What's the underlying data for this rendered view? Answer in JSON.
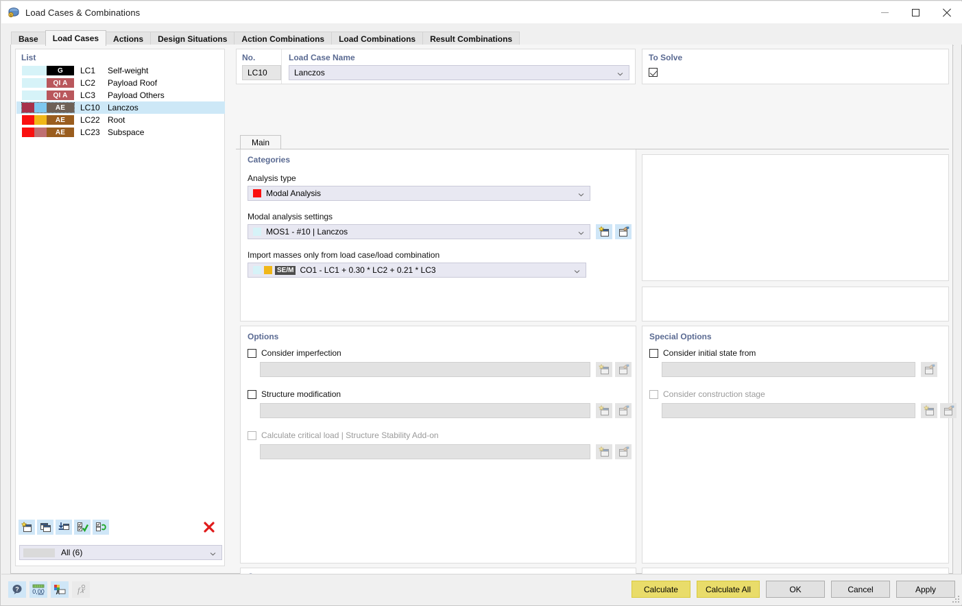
{
  "window": {
    "title": "Load Cases & Combinations",
    "icon": "load-cases-icon",
    "minimize": "minimize-icon",
    "maximize": "maximize-icon",
    "close": "close-icon"
  },
  "tabs": [
    {
      "label": "Base",
      "active": false
    },
    {
      "label": "Load Cases",
      "active": true
    },
    {
      "label": "Actions",
      "active": false
    },
    {
      "label": "Design Situations",
      "active": false
    },
    {
      "label": "Action Combinations",
      "active": false
    },
    {
      "label": "Load Combinations",
      "active": false
    },
    {
      "label": "Result Combinations",
      "active": false
    }
  ],
  "list": {
    "title": "List",
    "rows": [
      {
        "no": "LC1",
        "name": "Self-weight",
        "cat": "G",
        "c1": "#d6f3f8",
        "c2": "#d6f3f8",
        "cat_bg": "#000000",
        "selected": false
      },
      {
        "no": "LC2",
        "name": "Payload Roof",
        "cat": "QI A",
        "c1": "#d6f3f8",
        "c2": "#d6f3f8",
        "cat_bg": "#b9575c",
        "selected": false
      },
      {
        "no": "LC3",
        "name": "Payload Others",
        "cat": "QI A",
        "c1": "#d6f3f8",
        "c2": "#d6f3f8",
        "cat_bg": "#b9575c",
        "selected": false
      },
      {
        "no": "LC10",
        "name": "Lanczos",
        "cat": "AE",
        "c1": "#a8304a",
        "c2": "#7ec8ef",
        "cat_bg": "#6e6056",
        "selected": true
      },
      {
        "no": "LC22",
        "name": "Root",
        "cat": "AE",
        "c1": "#fa0f0f",
        "c2": "#f0b719",
        "cat_bg": "#9a5d1e",
        "selected": false
      },
      {
        "no": "LC23",
        "name": "Subspace",
        "cat": "AE",
        "c1": "#fa0f0f",
        "c2": "#bf6f72",
        "cat_bg": "#9a5d1e",
        "selected": false
      }
    ],
    "toolbar": [
      {
        "name": "new-load-case-button",
        "icon": "new-window-star-icon"
      },
      {
        "name": "copy-load-case-button",
        "icon": "copy-windows-icon"
      },
      {
        "name": "import-load-case-button",
        "icon": "import-down-arrow-icon"
      },
      {
        "name": "select-all-button",
        "icon": "checkbox-check-icon"
      },
      {
        "name": "invert-selection-button",
        "icon": "checkbox-swap-icon"
      },
      {
        "name": "delete-load-case-button",
        "icon": "red-x-icon"
      }
    ],
    "filter": {
      "value": "All (6)",
      "caret": "chevron-down-icon"
    }
  },
  "header": {
    "no_label": "No.",
    "no_value": "LC10",
    "name_label": "Load Case Name",
    "name_value": "Lanczos",
    "name_caret": "chevron-down-icon"
  },
  "to_solve": {
    "label": "To Solve",
    "checked": true
  },
  "main_tab": {
    "label": "Main"
  },
  "categories": {
    "title": "Categories",
    "analysis_type_label": "Analysis type",
    "analysis_type_value": "Modal Analysis",
    "analysis_type_color": "#fa0f0f",
    "analysis_type_caret": "chevron-down-icon",
    "modal_settings_label": "Modal analysis settings",
    "modal_settings_value": "MOS1 - #10 | Lanczos",
    "modal_settings_color": "#d6f3f8",
    "modal_settings_caret": "chevron-down-icon",
    "modal_new_icon": "new-window-star-icon",
    "modal_edit_icon": "edit-window-icon",
    "import_masses_label": "Import masses only from load case/load combination",
    "import_masses_value": "CO1 - LC1 + 0.30 * LC2 + 0.21 * LC3",
    "import_masses_badge": "SE/M",
    "import_masses_badge_bg": "#4d4d4d",
    "import_masses_c1": "#d6f3f8",
    "import_masses_c2": "#f0b719",
    "import_masses_caret": "chevron-down-icon"
  },
  "options": {
    "title": "Options",
    "items": [
      {
        "label": "Consider imperfection",
        "checked": false,
        "disabled": false,
        "value": "",
        "buttons": [
          "new-window-star-icon",
          "edit-window-icon"
        ]
      },
      {
        "label": "Structure modification",
        "checked": false,
        "disabled": false,
        "value": "",
        "buttons": [
          "new-window-star-icon",
          "edit-window-icon"
        ]
      },
      {
        "label": "Calculate critical load | Structure Stability Add-on",
        "checked": false,
        "disabled": true,
        "value": "",
        "buttons": [
          "new-window-star-icon",
          "edit-window-icon"
        ]
      }
    ]
  },
  "special_options": {
    "title": "Special Options",
    "items": [
      {
        "label": "Consider initial state from",
        "checked": false,
        "disabled": false,
        "value": "",
        "buttons": [
          "edit-window-icon"
        ]
      },
      {
        "label": "Consider construction stage",
        "checked": false,
        "disabled": true,
        "value": "",
        "buttons": [
          "new-window-star-icon",
          "edit-window-icon"
        ]
      }
    ]
  },
  "comment": {
    "title": "Comment",
    "value": "",
    "caret": "chevron-down-icon",
    "button_icon": "copy-pages-icon"
  },
  "statusbar": {
    "tools": [
      {
        "name": "help-info-button",
        "icon": "question-bubble-icon",
        "enabled": true
      },
      {
        "name": "decimal-places-button",
        "icon": "number-format-icon",
        "enabled": true
      },
      {
        "name": "display-properties-button",
        "icon": "color-palette-icon",
        "enabled": true
      },
      {
        "name": "formula-button",
        "icon": "function-fx-icon",
        "enabled": false
      }
    ],
    "buttons": [
      {
        "label": "Calculate",
        "accent": true
      },
      {
        "label": "Calculate All",
        "accent": true
      },
      {
        "label": "OK",
        "accent": false
      },
      {
        "label": "Cancel",
        "accent": false
      },
      {
        "label": "Apply",
        "accent": false
      }
    ]
  },
  "colors": {
    "accent_button": "#e9dc6a",
    "group_label": "#5a6a92",
    "selection": "#cde8f7",
    "combo_bg": "#e8e8f2",
    "panel_bg": "#f6f6f6"
  }
}
